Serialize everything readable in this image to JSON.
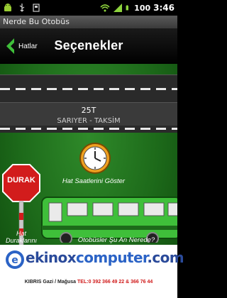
{
  "status_bar": {
    "battery_percent": "100",
    "time": "3:46",
    "left_icons": [
      "android-icon",
      "usb-icon",
      "card-icon"
    ],
    "right_icons": [
      "wifi-icon",
      "signal-icon",
      "battery-icon"
    ]
  },
  "app": {
    "window_title": "Nerde Bu Otobüs"
  },
  "topbar": {
    "back_label": "Hatlar",
    "title": "Seçenekler"
  },
  "route": {
    "code": "25T",
    "name": "SARIYER - TAKSİM"
  },
  "options": {
    "schedule_label": "Hat Saatlerini Göster",
    "stop_sign_label": "DURAK",
    "stops_label": "Hat Duraklarını",
    "bus_question": "Otobüsler Şu An Nerede?"
  },
  "watermark": {
    "e_letter": "e",
    "part1": "ekinox",
    "part2": "computer",
    "part3": ".com",
    "footer_bold": "KIBRIS Gazi / Mağusa",
    "footer_tel": "TEL:0 392 366 49 22 & 366 76 44"
  },
  "colors": {
    "background_green": "#1d6a1a",
    "accent_green": "#2fae2a",
    "bus_green": "#3fbf3a",
    "sign_red": "#d21c1c"
  }
}
